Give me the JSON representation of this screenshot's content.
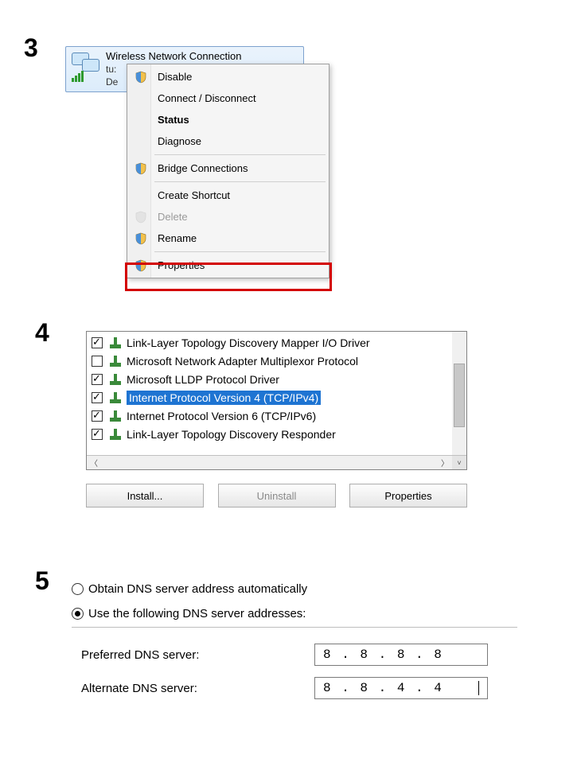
{
  "steps": {
    "s3": "3",
    "s4": "4",
    "s5": "5"
  },
  "adapter": {
    "title": "Wireless Network Connection",
    "line2": "tu:",
    "line3": "De"
  },
  "ctx": {
    "disable": "Disable",
    "connect": "Connect / Disconnect",
    "status": "Status",
    "diagnose": "Diagnose",
    "bridge": "Bridge Connections",
    "shortcut": "Create Shortcut",
    "delete": "Delete",
    "rename": "Rename",
    "properties": "Properties"
  },
  "protocols": [
    {
      "checked": true,
      "label": "Link-Layer Topology Discovery Mapper I/O Driver"
    },
    {
      "checked": false,
      "label": "Microsoft Network Adapter Multiplexor Protocol"
    },
    {
      "checked": true,
      "label": "Microsoft LLDP Protocol Driver"
    },
    {
      "checked": true,
      "label": "Internet Protocol Version 4 (TCP/IPv4)",
      "selected": true
    },
    {
      "checked": true,
      "label": "Internet Protocol Version 6 (TCP/IPv6)"
    },
    {
      "checked": true,
      "label": "Link-Layer Topology Discovery Responder"
    }
  ],
  "buttons": {
    "install": "Install...",
    "uninstall": "Uninstall",
    "properties": "Properties"
  },
  "dns": {
    "auto": "Obtain DNS server address automatically",
    "manual": "Use the following DNS server addresses:",
    "preferred_label": "Preferred DNS server:",
    "alternate_label": "Alternate DNS server:",
    "preferred_value": "8 . 8 . 8 . 8",
    "alternate_value": "8 . 8 . 4 . 4"
  }
}
